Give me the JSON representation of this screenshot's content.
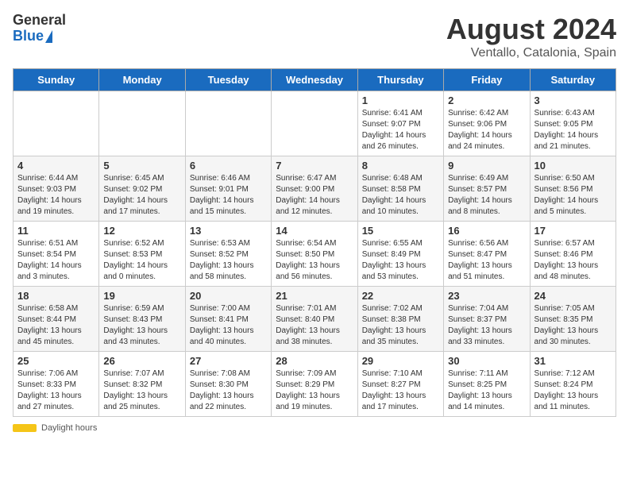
{
  "logo": {
    "general": "General",
    "blue": "Blue"
  },
  "title": "August 2024",
  "subtitle": "Ventallo, Catalonia, Spain",
  "days_of_week": [
    "Sunday",
    "Monday",
    "Tuesday",
    "Wednesday",
    "Thursday",
    "Friday",
    "Saturday"
  ],
  "weeks": [
    [
      {
        "day": "",
        "info": ""
      },
      {
        "day": "",
        "info": ""
      },
      {
        "day": "",
        "info": ""
      },
      {
        "day": "",
        "info": ""
      },
      {
        "day": "1",
        "info": "Sunrise: 6:41 AM\nSunset: 9:07 PM\nDaylight: 14 hours and 26 minutes."
      },
      {
        "day": "2",
        "info": "Sunrise: 6:42 AM\nSunset: 9:06 PM\nDaylight: 14 hours and 24 minutes."
      },
      {
        "day": "3",
        "info": "Sunrise: 6:43 AM\nSunset: 9:05 PM\nDaylight: 14 hours and 21 minutes."
      }
    ],
    [
      {
        "day": "4",
        "info": "Sunrise: 6:44 AM\nSunset: 9:03 PM\nDaylight: 14 hours and 19 minutes."
      },
      {
        "day": "5",
        "info": "Sunrise: 6:45 AM\nSunset: 9:02 PM\nDaylight: 14 hours and 17 minutes."
      },
      {
        "day": "6",
        "info": "Sunrise: 6:46 AM\nSunset: 9:01 PM\nDaylight: 14 hours and 15 minutes."
      },
      {
        "day": "7",
        "info": "Sunrise: 6:47 AM\nSunset: 9:00 PM\nDaylight: 14 hours and 12 minutes."
      },
      {
        "day": "8",
        "info": "Sunrise: 6:48 AM\nSunset: 8:58 PM\nDaylight: 14 hours and 10 minutes."
      },
      {
        "day": "9",
        "info": "Sunrise: 6:49 AM\nSunset: 8:57 PM\nDaylight: 14 hours and 8 minutes."
      },
      {
        "day": "10",
        "info": "Sunrise: 6:50 AM\nSunset: 8:56 PM\nDaylight: 14 hours and 5 minutes."
      }
    ],
    [
      {
        "day": "11",
        "info": "Sunrise: 6:51 AM\nSunset: 8:54 PM\nDaylight: 14 hours and 3 minutes."
      },
      {
        "day": "12",
        "info": "Sunrise: 6:52 AM\nSunset: 8:53 PM\nDaylight: 14 hours and 0 minutes."
      },
      {
        "day": "13",
        "info": "Sunrise: 6:53 AM\nSunset: 8:52 PM\nDaylight: 13 hours and 58 minutes."
      },
      {
        "day": "14",
        "info": "Sunrise: 6:54 AM\nSunset: 8:50 PM\nDaylight: 13 hours and 56 minutes."
      },
      {
        "day": "15",
        "info": "Sunrise: 6:55 AM\nSunset: 8:49 PM\nDaylight: 13 hours and 53 minutes."
      },
      {
        "day": "16",
        "info": "Sunrise: 6:56 AM\nSunset: 8:47 PM\nDaylight: 13 hours and 51 minutes."
      },
      {
        "day": "17",
        "info": "Sunrise: 6:57 AM\nSunset: 8:46 PM\nDaylight: 13 hours and 48 minutes."
      }
    ],
    [
      {
        "day": "18",
        "info": "Sunrise: 6:58 AM\nSunset: 8:44 PM\nDaylight: 13 hours and 45 minutes."
      },
      {
        "day": "19",
        "info": "Sunrise: 6:59 AM\nSunset: 8:43 PM\nDaylight: 13 hours and 43 minutes."
      },
      {
        "day": "20",
        "info": "Sunrise: 7:00 AM\nSunset: 8:41 PM\nDaylight: 13 hours and 40 minutes."
      },
      {
        "day": "21",
        "info": "Sunrise: 7:01 AM\nSunset: 8:40 PM\nDaylight: 13 hours and 38 minutes."
      },
      {
        "day": "22",
        "info": "Sunrise: 7:02 AM\nSunset: 8:38 PM\nDaylight: 13 hours and 35 minutes."
      },
      {
        "day": "23",
        "info": "Sunrise: 7:04 AM\nSunset: 8:37 PM\nDaylight: 13 hours and 33 minutes."
      },
      {
        "day": "24",
        "info": "Sunrise: 7:05 AM\nSunset: 8:35 PM\nDaylight: 13 hours and 30 minutes."
      }
    ],
    [
      {
        "day": "25",
        "info": "Sunrise: 7:06 AM\nSunset: 8:33 PM\nDaylight: 13 hours and 27 minutes."
      },
      {
        "day": "26",
        "info": "Sunrise: 7:07 AM\nSunset: 8:32 PM\nDaylight: 13 hours and 25 minutes."
      },
      {
        "day": "27",
        "info": "Sunrise: 7:08 AM\nSunset: 8:30 PM\nDaylight: 13 hours and 22 minutes."
      },
      {
        "day": "28",
        "info": "Sunrise: 7:09 AM\nSunset: 8:29 PM\nDaylight: 13 hours and 19 minutes."
      },
      {
        "day": "29",
        "info": "Sunrise: 7:10 AM\nSunset: 8:27 PM\nDaylight: 13 hours and 17 minutes."
      },
      {
        "day": "30",
        "info": "Sunrise: 7:11 AM\nSunset: 8:25 PM\nDaylight: 13 hours and 14 minutes."
      },
      {
        "day": "31",
        "info": "Sunrise: 7:12 AM\nSunset: 8:24 PM\nDaylight: 13 hours and 11 minutes."
      }
    ]
  ],
  "footer": {
    "daylight_label": "Daylight hours"
  }
}
